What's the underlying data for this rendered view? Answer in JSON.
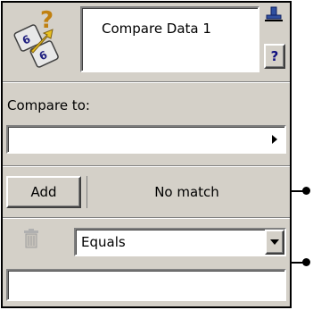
{
  "node": {
    "title": "Compare Data 1",
    "help_label": "?",
    "compare_to_label": "Compare to:",
    "compare_to_value": "",
    "add_label": "Add",
    "match_status": "No match",
    "operator_selected": "Equals",
    "value_field": ""
  },
  "icons": {
    "node_icon": "compare-data-icon",
    "pin_icon": "pin-icon",
    "delete_icon": "trash-icon",
    "arrow_icon": "play-right-icon",
    "dropdown_icon": "chevron-down-icon"
  },
  "colors": {
    "panel_bg": "#d4d0c8",
    "border": "#000000",
    "connector": "#000000"
  }
}
